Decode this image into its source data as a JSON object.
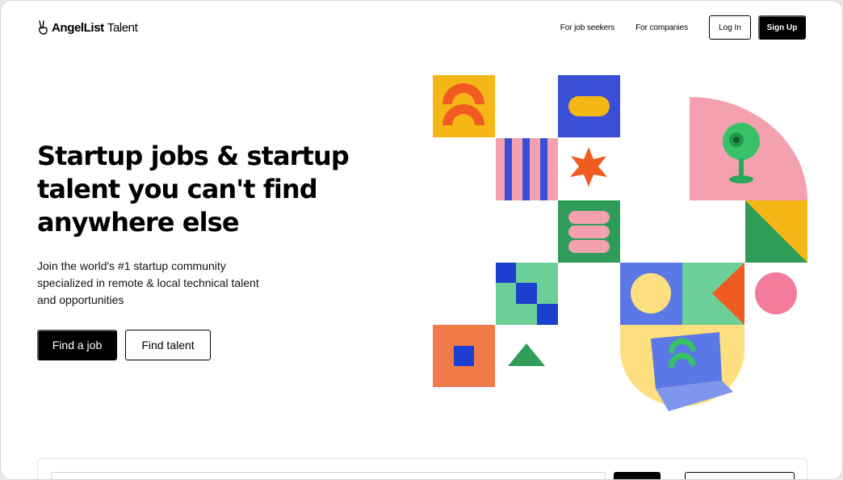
{
  "header": {
    "logo_brand": "AngelList",
    "logo_product": "Talent",
    "nav": {
      "job_seekers": "For job seekers",
      "companies": "For companies",
      "login": "Log In",
      "signup": "Sign Up"
    }
  },
  "hero": {
    "title": "Startup jobs & startup talent you can't find anywhere else",
    "subtitle": "Join the world's #1 startup community specialized in remote & local technical talent and opportunities",
    "find_job": "Find a job",
    "find_talent": "Find talent"
  },
  "icons": {
    "logo": "peace-hand-icon",
    "illustration": "geometric-mosaic-illustration"
  },
  "colors": {
    "primary": "#000000",
    "yellow": "#f5b716",
    "orange": "#f05b22",
    "blue": "#3a4fd6",
    "pink": "#f4a0ae",
    "green": "#2f9c58",
    "mint": "#6ccf98",
    "light_yellow": "#fddf7f"
  }
}
